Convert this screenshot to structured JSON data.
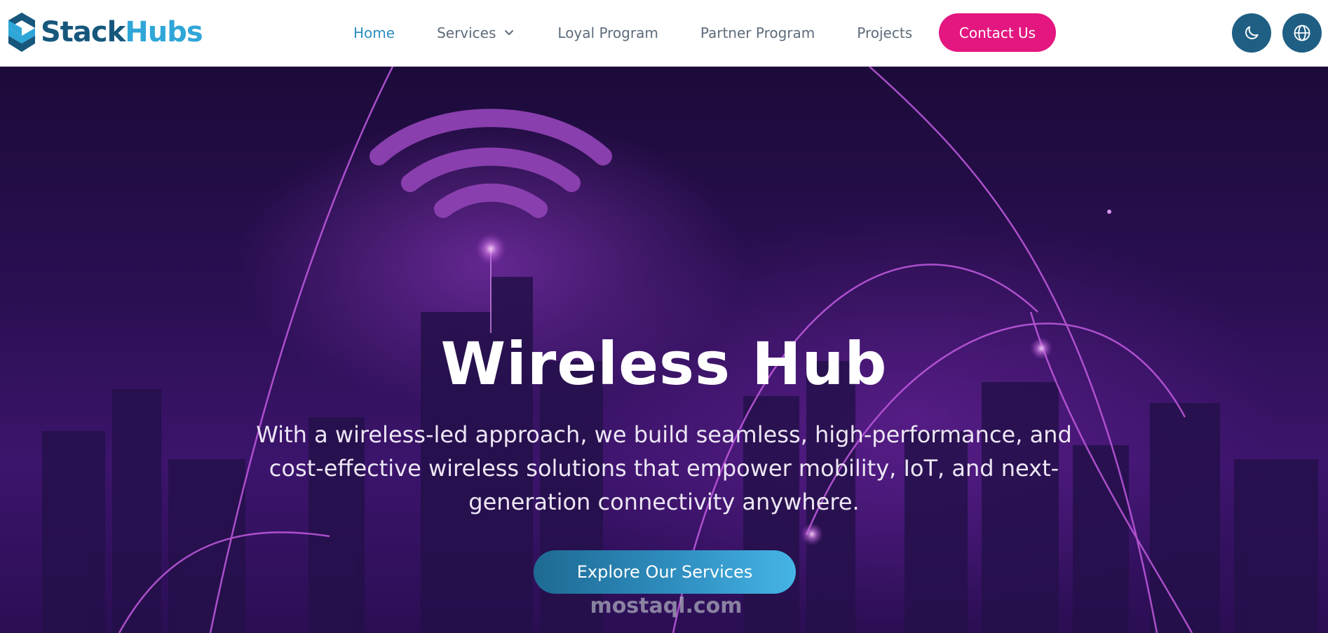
{
  "brand": {
    "name_part1": "Stack",
    "name_part2": "Hubs",
    "colors": {
      "primary": "#17577c",
      "secondary": "#2fa6d8"
    }
  },
  "nav": {
    "items": [
      {
        "label": "Home",
        "active": true
      },
      {
        "label": "Services",
        "has_dropdown": true
      },
      {
        "label": "Loyal Program"
      },
      {
        "label": "Partner Program"
      },
      {
        "label": "Projects"
      }
    ],
    "contact_label": "Contact Us",
    "theme_icon": "moon-icon",
    "language_icon": "globe-icon"
  },
  "hero": {
    "title": "Wireless Hub",
    "description": "With a wireless-led approach, we build seamless, high-performance, and cost-effective wireless solutions that empower mobility, IoT, and next-generation connectivity anywhere.",
    "cta_label": "Explore Our Services"
  },
  "watermark": {
    "text": "mostaql.com"
  },
  "colors": {
    "accent": "#e3177f",
    "nav_active": "#2b8fc0",
    "hero_bg": "#2a0f52"
  }
}
